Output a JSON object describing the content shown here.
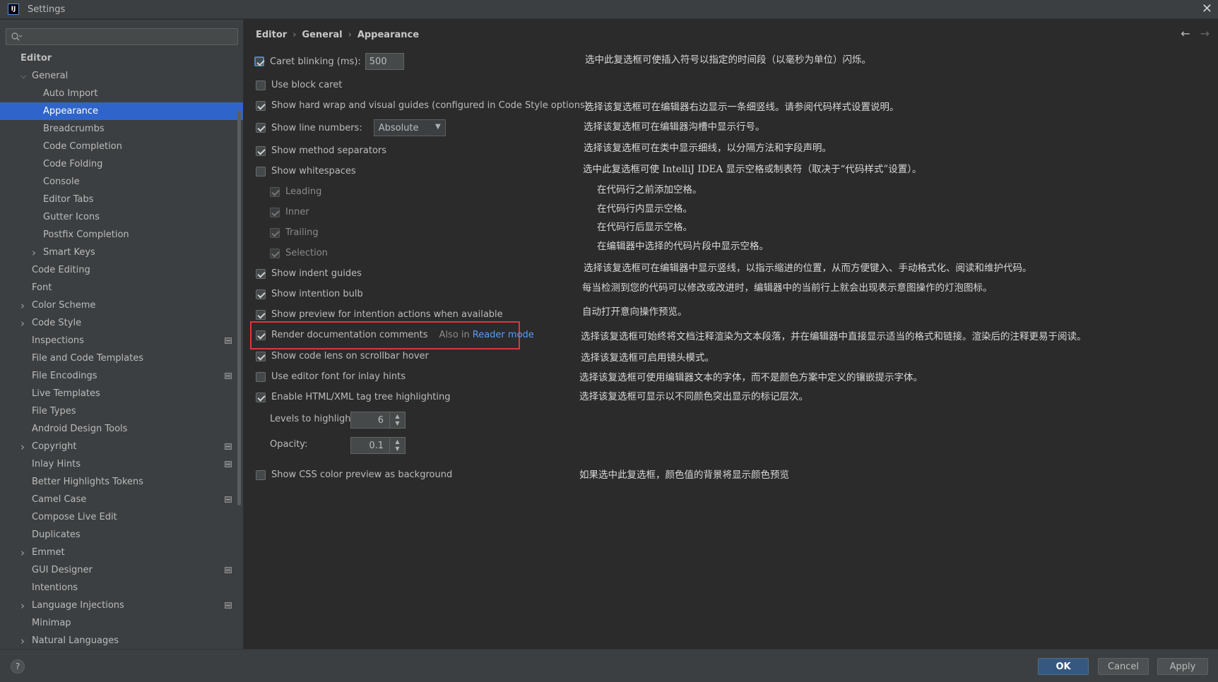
{
  "window": {
    "title": "Settings",
    "app_icon_label": "IJ"
  },
  "search": {
    "placeholder": ""
  },
  "breadcrumb": [
    "Editor",
    "General",
    "Appearance"
  ],
  "sidebar": {
    "items": [
      {
        "label": "Editor",
        "level": 0,
        "bold": true
      },
      {
        "label": "General",
        "level": 1,
        "expanded": true
      },
      {
        "label": "Auto Import",
        "level": 2
      },
      {
        "label": "Appearance",
        "level": 2,
        "selected": true
      },
      {
        "label": "Breadcrumbs",
        "level": 2
      },
      {
        "label": "Code Completion",
        "level": 2
      },
      {
        "label": "Code Folding",
        "level": 2
      },
      {
        "label": "Console",
        "level": 2
      },
      {
        "label": "Editor Tabs",
        "level": 2
      },
      {
        "label": "Gutter Icons",
        "level": 2
      },
      {
        "label": "Postfix Completion",
        "level": 2
      },
      {
        "label": "Smart Keys",
        "level": 2,
        "collapsed": true
      },
      {
        "label": "Code Editing",
        "level": 1
      },
      {
        "label": "Font",
        "level": 1
      },
      {
        "label": "Color Scheme",
        "level": 1,
        "collapsed": true
      },
      {
        "label": "Code Style",
        "level": 1,
        "collapsed": true
      },
      {
        "label": "Inspections",
        "level": 1,
        "project_icon": true
      },
      {
        "label": "File and Code Templates",
        "level": 1
      },
      {
        "label": "File Encodings",
        "level": 1,
        "project_icon": true
      },
      {
        "label": "Live Templates",
        "level": 1
      },
      {
        "label": "File Types",
        "level": 1
      },
      {
        "label": "Android Design Tools",
        "level": 1
      },
      {
        "label": "Copyright",
        "level": 1,
        "collapsed": true,
        "project_icon": true
      },
      {
        "label": "Inlay Hints",
        "level": 1,
        "project_icon": true
      },
      {
        "label": "Better Highlights Tokens",
        "level": 1
      },
      {
        "label": "Camel Case",
        "level": 1,
        "project_icon": true
      },
      {
        "label": "Compose Live Edit",
        "level": 1
      },
      {
        "label": "Duplicates",
        "level": 1
      },
      {
        "label": "Emmet",
        "level": 1,
        "collapsed": true
      },
      {
        "label": "GUI Designer",
        "level": 1,
        "project_icon": true
      },
      {
        "label": "Intentions",
        "level": 1
      },
      {
        "label": "Language Injections",
        "level": 1,
        "collapsed": true,
        "project_icon": true
      },
      {
        "label": "Minimap",
        "level": 1
      },
      {
        "label": "Natural Languages",
        "level": 1,
        "collapsed": true
      }
    ]
  },
  "options": {
    "caret_blinking": {
      "label": "Caret blinking (ms):",
      "value": "500",
      "checked": true
    },
    "block_caret": {
      "label": "Use block caret",
      "checked": false
    },
    "hard_wrap": {
      "label": "Show hard wrap and visual guides (configured in Code Style options)",
      "checked": true
    },
    "line_numbers": {
      "label": "Show line numbers:",
      "value": "Absolute",
      "checked": true
    },
    "method_separators": {
      "label": "Show method separators",
      "checked": true
    },
    "whitespaces": {
      "label": "Show whitespaces",
      "checked": false
    },
    "leading": {
      "label": "Leading",
      "checked": true
    },
    "inner": {
      "label": "Inner",
      "checked": true
    },
    "trailing": {
      "label": "Trailing",
      "checked": true
    },
    "selection": {
      "label": "Selection",
      "checked": true
    },
    "indent_guides": {
      "label": "Show indent guides",
      "checked": true
    },
    "intention_bulb": {
      "label": "Show intention bulb",
      "checked": true
    },
    "preview_intention": {
      "label": "Show preview for intention actions when available",
      "checked": true
    },
    "render_docs": {
      "label": "Render documentation comments",
      "also_in": "Also in",
      "link": "Reader mode",
      "checked": true
    },
    "code_lens": {
      "label": "Show code lens on scrollbar hover",
      "checked": true
    },
    "editor_font_inlay": {
      "label": "Use editor font for inlay hints",
      "checked": false
    },
    "html_xml_tree": {
      "label": "Enable HTML/XML tag tree highlighting",
      "checked": true
    },
    "levels": {
      "label": "Levels to highlight:",
      "value": "6"
    },
    "opacity": {
      "label": "Opacity:",
      "value": "0.1"
    },
    "css_color_preview": {
      "label": "Show CSS color preview as background",
      "checked": false
    }
  },
  "descriptions": {
    "caret_blinking": "选中此复选框可使插入符号以指定的时间段（以毫秒为单位）闪烁。",
    "hard_wrap": "选择该复选框可在编辑器右边显示一条细竖线。请参阅代码样式设置说明。",
    "line_numbers": "选择该复选框可在编辑器沟槽中显示行号。",
    "method_separators": "选择该复选框可在类中显示细线，以分隔方法和字段声明。",
    "whitespaces": "选中此复选框可使 IntelliJ IDEA 显示空格或制表符（取决于“代码样式”设置）。",
    "leading": "在代码行之前添加空格。",
    "inner": "在代码行内显示空格。",
    "trailing": "在代码行后显示空格。",
    "selection": "在编辑器中选择的代码片段中显示空格。",
    "indent_guides": "选择该复选框可在编辑器中显示竖线，以指示缩进的位置，从而方便键入、手动格式化、阅读和维护代码。",
    "intention_bulb": "每当检测到您的代码可以修改或改进时，编辑器中的当前行上就会出现表示意图操作的灯泡图标。",
    "preview_intention": "自动打开意向操作预览。",
    "render_docs": "选择该复选框可始终将文档注释渲染为文本段落，并在编辑器中直接显示适当的格式和链接。渲染后的注释更易于阅读。",
    "code_lens": "选择该复选框可启用镜头模式。",
    "editor_font_inlay": "选择该复选框可使用编辑器文本的字体，而不是颜色方案中定义的镶嵌提示字体。",
    "html_xml_tree": "选择该复选框可显示以不同颜色突出显示的标记层次。",
    "css_color_preview": "如果选中此复选框，颜色值的背景将显示颜色预览"
  },
  "footer": {
    "help": "?",
    "ok": "OK",
    "cancel": "Cancel",
    "apply": "Apply"
  }
}
